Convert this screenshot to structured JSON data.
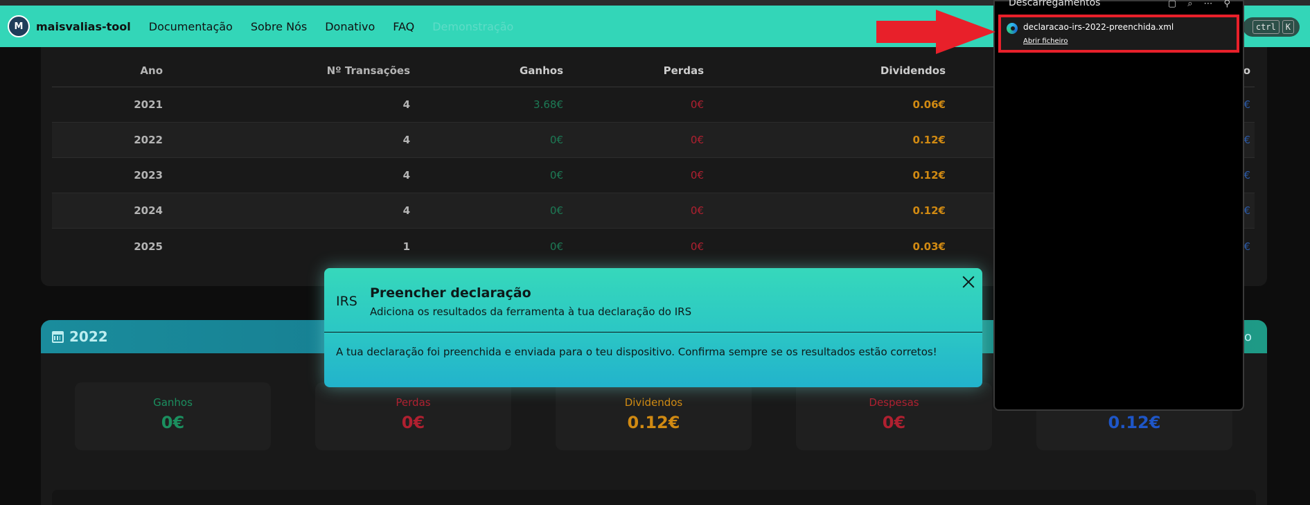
{
  "navbar": {
    "logo_text": "M",
    "brand": "maisvalias-tool",
    "links": [
      "Documentação",
      "Sobre Nós",
      "Donativo",
      "FAQ",
      "Demonstração"
    ],
    "shortcut_keys": [
      "ctrl",
      "K"
    ]
  },
  "table": {
    "headers": {
      "ano": "Ano",
      "transacoes": "Nº Transações",
      "ganhos": "Ganhos",
      "perdas": "Perdas",
      "dividendos": "Dividendos",
      "partial": "o"
    },
    "rows": [
      {
        "ano": "2021",
        "transacoes": "4",
        "ganhos": "3.68€",
        "perdas": "0€",
        "dividendos": "0.06€",
        "partial": "€"
      },
      {
        "ano": "2022",
        "transacoes": "4",
        "ganhos": "0€",
        "perdas": "0€",
        "dividendos": "0.12€",
        "partial": "€"
      },
      {
        "ano": "2023",
        "transacoes": "4",
        "ganhos": "0€",
        "perdas": "0€",
        "dividendos": "0.12€",
        "partial": "€"
      },
      {
        "ano": "2024",
        "transacoes": "4",
        "ganhos": "0€",
        "perdas": "0€",
        "dividendos": "0.12€",
        "partial": "€"
      },
      {
        "ano": "2025",
        "transacoes": "1",
        "ganhos": "0€",
        "perdas": "0€",
        "dividendos": "0.03€",
        "partial": "€"
      }
    ]
  },
  "year_section": {
    "title": "2022",
    "header_partial": "o",
    "stats": [
      {
        "label": "Ganhos",
        "value": "0€",
        "color": "#1b8f5f"
      },
      {
        "label": "Perdas",
        "value": "0€",
        "color": "#b02030"
      },
      {
        "label": "Dividendos",
        "value": "0.12€",
        "color": "#d18a12"
      },
      {
        "label": "Despesas",
        "value": "0€",
        "color": "#b02030"
      },
      {
        "label": "",
        "value": "0.12€",
        "color": "#1e56c8"
      }
    ]
  },
  "modal": {
    "icon_text": "IRS",
    "title": "Preencher declaração",
    "subtitle": "Adiciona os resultados da ferramenta à tua declaração do IRS",
    "body": "A tua declaração foi preenchida e enviada para o teu dispositivo. Confirma sempre se os resultados estão corretos!"
  },
  "downloads": {
    "title": "Descarregamentos",
    "file_name": "declaracao-irs-2022-preenchida.xml",
    "open_label": "Abrir ficheiro",
    "highlight_color": "#e8202a"
  }
}
